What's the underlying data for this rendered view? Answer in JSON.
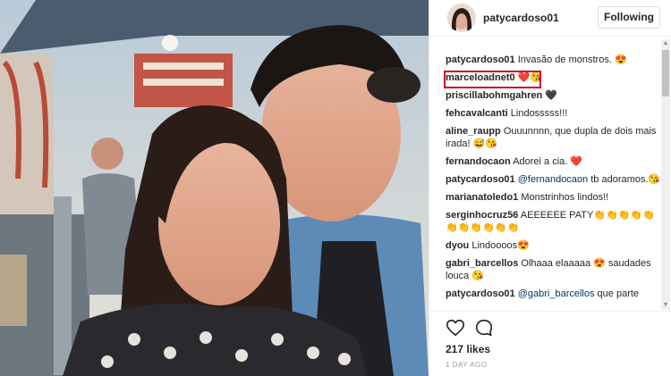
{
  "header": {
    "username": "patycardoso01",
    "follow_label": "Following"
  },
  "comments": [
    {
      "user": "patycardoso01",
      "text": "Invasão de monstros. 😍"
    },
    {
      "user": "marceloadnet0",
      "text": "❤️😘"
    },
    {
      "user": "priscillabohmgahren",
      "text": "🖤"
    },
    {
      "user": "fehcavalcanti",
      "text": "Lindosssss!!!"
    },
    {
      "user": "aline_raupp",
      "text": "Ouuunnnn, que dupla de dois mais irada! 😅😘"
    },
    {
      "user": "fernandocaon",
      "text": "Adorei a cia. ❤️"
    },
    {
      "user": "patycardoso01",
      "mention": "@fernandocaon",
      "text": "tb adoramos.😘"
    },
    {
      "user": "marianatoledo1",
      "text": "Monstrinhos lindos!!"
    },
    {
      "user": "serginhocruz56",
      "text": "AEEEEEE PATY👏👏👏👏👏👏👏👏👏👏👏"
    },
    {
      "user": "dyou",
      "text": "Lindoooos😍"
    },
    {
      "user": "gabri_barcellos",
      "text": "Olhaaa elaaaaa 😍 saudades louca 😘"
    },
    {
      "user": "patycardoso01",
      "mention": "@gabri_barcellos",
      "text": "que parte"
    }
  ],
  "footer": {
    "likes": "217 likes",
    "timestamp": "1 DAY AGO"
  },
  "icons": {
    "like": "heart-icon",
    "comment": "comment-bubble-icon"
  },
  "colors": {
    "highlight_border": "#c8102e",
    "mention": "#003569",
    "text": "#262626",
    "muted": "#999999"
  }
}
